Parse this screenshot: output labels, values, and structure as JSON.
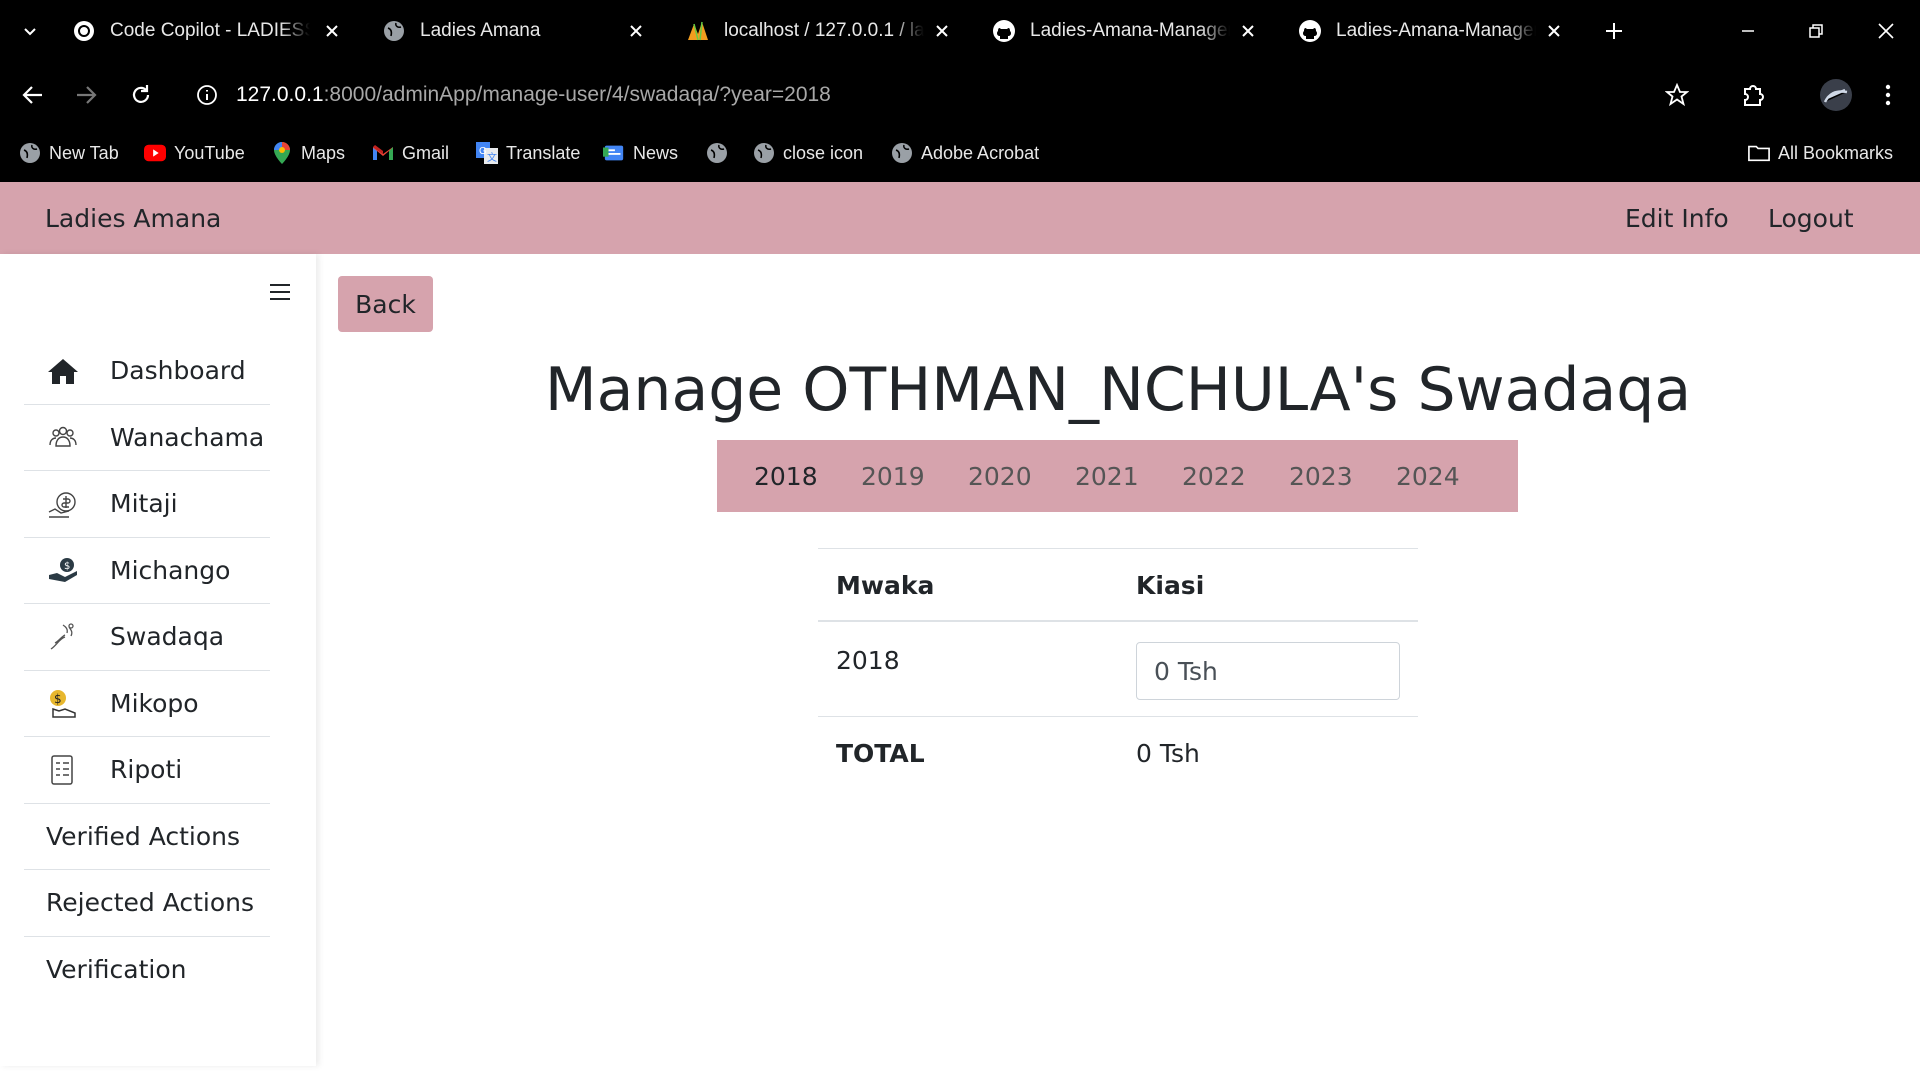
{
  "browser": {
    "tabs": [
      {
        "title": "Code Copilot - LADIESS-S",
        "icon": "openai-icon"
      },
      {
        "title": "Ladies Amana",
        "icon": "globe-icon"
      },
      {
        "title": "localhost / 127.0.0.1 / lad",
        "icon": "phpmyadmin-icon"
      },
      {
        "title": "Ladies-Amana-Managem",
        "icon": "github-icon"
      },
      {
        "title": "Ladies-Amana-Managem",
        "icon": "github-icon"
      }
    ],
    "url_host": "127.0.0.1",
    "url_path": ":8000/adminApp/manage-user/4/swadaqa/?year=2018",
    "bookmarks": [
      {
        "label": "New Tab",
        "icon": "globe-icon"
      },
      {
        "label": "YouTube",
        "icon": "youtube-icon"
      },
      {
        "label": "Maps",
        "icon": "maps-icon"
      },
      {
        "label": "Gmail",
        "icon": "gmail-icon"
      },
      {
        "label": "Translate",
        "icon": "translate-icon"
      },
      {
        "label": "News",
        "icon": "news-icon"
      },
      {
        "label": "",
        "icon": "globe-icon"
      },
      {
        "label": "close icon",
        "icon": "globe-icon"
      },
      {
        "label": "Adobe Acrobat",
        "icon": "globe-icon"
      }
    ],
    "all_bookmarks": "All Bookmarks"
  },
  "app": {
    "brand": "Ladies Amana",
    "nav_edit": "Edit Info",
    "nav_logout": "Logout",
    "sidebar": [
      {
        "label": "Dashboard",
        "icon": "home-icon"
      },
      {
        "label": "Wanachama",
        "icon": "members-icon"
      },
      {
        "label": "Mitaji",
        "icon": "money-bag-icon"
      },
      {
        "label": "Michango",
        "icon": "hand-coin-icon"
      },
      {
        "label": "Swadaqa",
        "icon": "charity-icon"
      },
      {
        "label": "Mikopo",
        "icon": "loan-icon"
      },
      {
        "label": "Ripoti",
        "icon": "report-icon"
      },
      {
        "label": "Verified Actions",
        "icon": ""
      },
      {
        "label": "Rejected Actions",
        "icon": ""
      },
      {
        "label": "Verification",
        "icon": ""
      }
    ],
    "back": "Back",
    "title": "Manage OTHMAN_NCHULA's Swadaqa",
    "years": [
      "2018",
      "2019",
      "2020",
      "2021",
      "2022",
      "2023",
      "2024"
    ],
    "active_year": "2018",
    "table": {
      "col_year": "Mwaka",
      "col_amount": "Kiasi",
      "row_year": "2018",
      "row_amount": "0 Tsh",
      "total_label": "TOTAL",
      "total_amount": "0 Tsh"
    }
  }
}
